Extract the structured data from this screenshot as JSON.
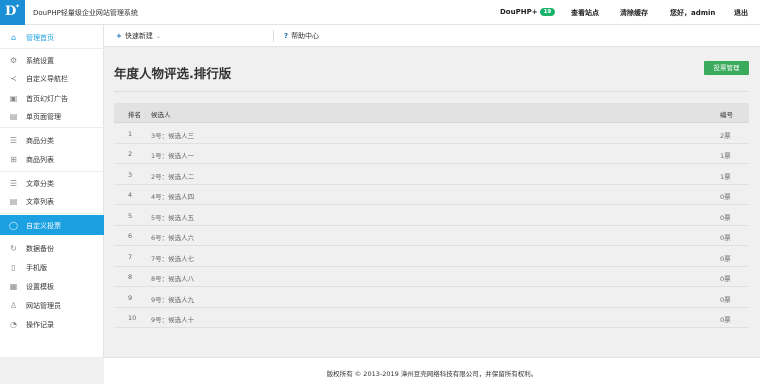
{
  "header": {
    "logo_text": "D",
    "site_title": "DouPHP轻量级企业网站管理系统",
    "product": "DouPHP+",
    "product_badge": "19",
    "view_site": "查看站点",
    "clear_cache": "清除缓存",
    "greeting": "您好，admin",
    "logout": "退出"
  },
  "sidebar": {
    "items": [
      {
        "label": "管理首页",
        "icon": "home-icon"
      },
      {
        "label": "系统设置",
        "icon": "gear-icon"
      },
      {
        "label": "自定义导航栏",
        "icon": "share-icon"
      },
      {
        "label": "首页幻灯广告",
        "icon": "image-icon"
      },
      {
        "label": "单页面管理",
        "icon": "document-icon"
      },
      {
        "label": "商品分类",
        "icon": "list-icon"
      },
      {
        "label": "商品列表",
        "icon": "grid-icon"
      },
      {
        "label": "文章分类",
        "icon": "list-icon"
      },
      {
        "label": "文章列表",
        "icon": "document-icon"
      },
      {
        "label": "自定义投票",
        "icon": "circle-icon"
      },
      {
        "label": "数据备份",
        "icon": "refresh-icon"
      },
      {
        "label": "手机版",
        "icon": "mobile-icon"
      },
      {
        "label": "设置模板",
        "icon": "template-icon"
      },
      {
        "label": "网站管理员",
        "icon": "user-icon"
      },
      {
        "label": "操作记录",
        "icon": "clock-icon"
      }
    ]
  },
  "subbar": {
    "quick_new": "快速新建",
    "help": "帮助中心"
  },
  "main": {
    "title": "年度人物评选.排行版",
    "manage_button": "投票管理",
    "table": {
      "headers": {
        "rank": "排名",
        "candidate": "候选人",
        "votes": "编号"
      },
      "rows": [
        {
          "rank": "1",
          "candidate": "3号：候选人三",
          "votes": "2票"
        },
        {
          "rank": "2",
          "candidate": "1号：候选人一",
          "votes": "1票"
        },
        {
          "rank": "3",
          "candidate": "2号：候选人二",
          "votes": "1票"
        },
        {
          "rank": "4",
          "candidate": "4号：候选人四",
          "votes": "0票"
        },
        {
          "rank": "5",
          "candidate": "5号：候选人五",
          "votes": "0票"
        },
        {
          "rank": "6",
          "candidate": "6号：候选人六",
          "votes": "0票"
        },
        {
          "rank": "7",
          "candidate": "7号：候选人七",
          "votes": "0票"
        },
        {
          "rank": "8",
          "candidate": "8号：候选人八",
          "votes": "0票"
        },
        {
          "rank": "9",
          "candidate": "9号：候选人九",
          "votes": "0票"
        },
        {
          "rank": "10",
          "candidate": "9号：候选人十",
          "votes": "0票"
        }
      ]
    }
  },
  "footer": {
    "copyright": "版权所有 © 2013-2019 漳州豆壳网络科技有限公司，并保留所有权利。"
  }
}
